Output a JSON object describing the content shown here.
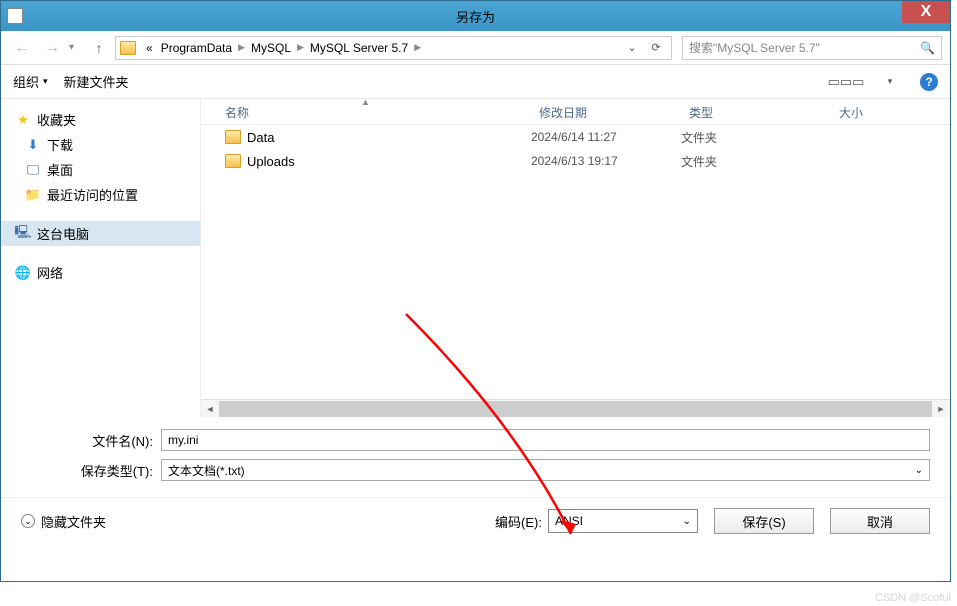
{
  "title": "另存为",
  "breadcrumbs": [
    "ProgramData",
    "MySQL",
    "MySQL Server 5.7"
  ],
  "breadcrumb_prefix": "«",
  "search": {
    "placeholder": "搜索\"MySQL Server 5.7\""
  },
  "toolbar": {
    "organize": "组织",
    "new_folder": "新建文件夹"
  },
  "sidebar": {
    "favorites": "收藏夹",
    "downloads": "下载",
    "desktop": "桌面",
    "recent": "最近访问的位置",
    "this_pc": "这台电脑",
    "network": "网络"
  },
  "columns": {
    "name": "名称",
    "date": "修改日期",
    "type": "类型",
    "size": "大小"
  },
  "files": [
    {
      "name": "Data",
      "date": "2024/6/14 11:27",
      "type": "文件夹"
    },
    {
      "name": "Uploads",
      "date": "2024/6/13 19:17",
      "type": "文件夹"
    }
  ],
  "form": {
    "filename_label": "文件名(N):",
    "filename_value": "my.ini",
    "filetype_label": "保存类型(T):",
    "filetype_value": "文本文档(*.txt)",
    "encoding_label": "编码(E):",
    "encoding_value": "ANSI"
  },
  "actions": {
    "hide_folders": "隐藏文件夹",
    "save": "保存(S)",
    "cancel": "取消"
  },
  "watermark": "CSDN @Scoful"
}
